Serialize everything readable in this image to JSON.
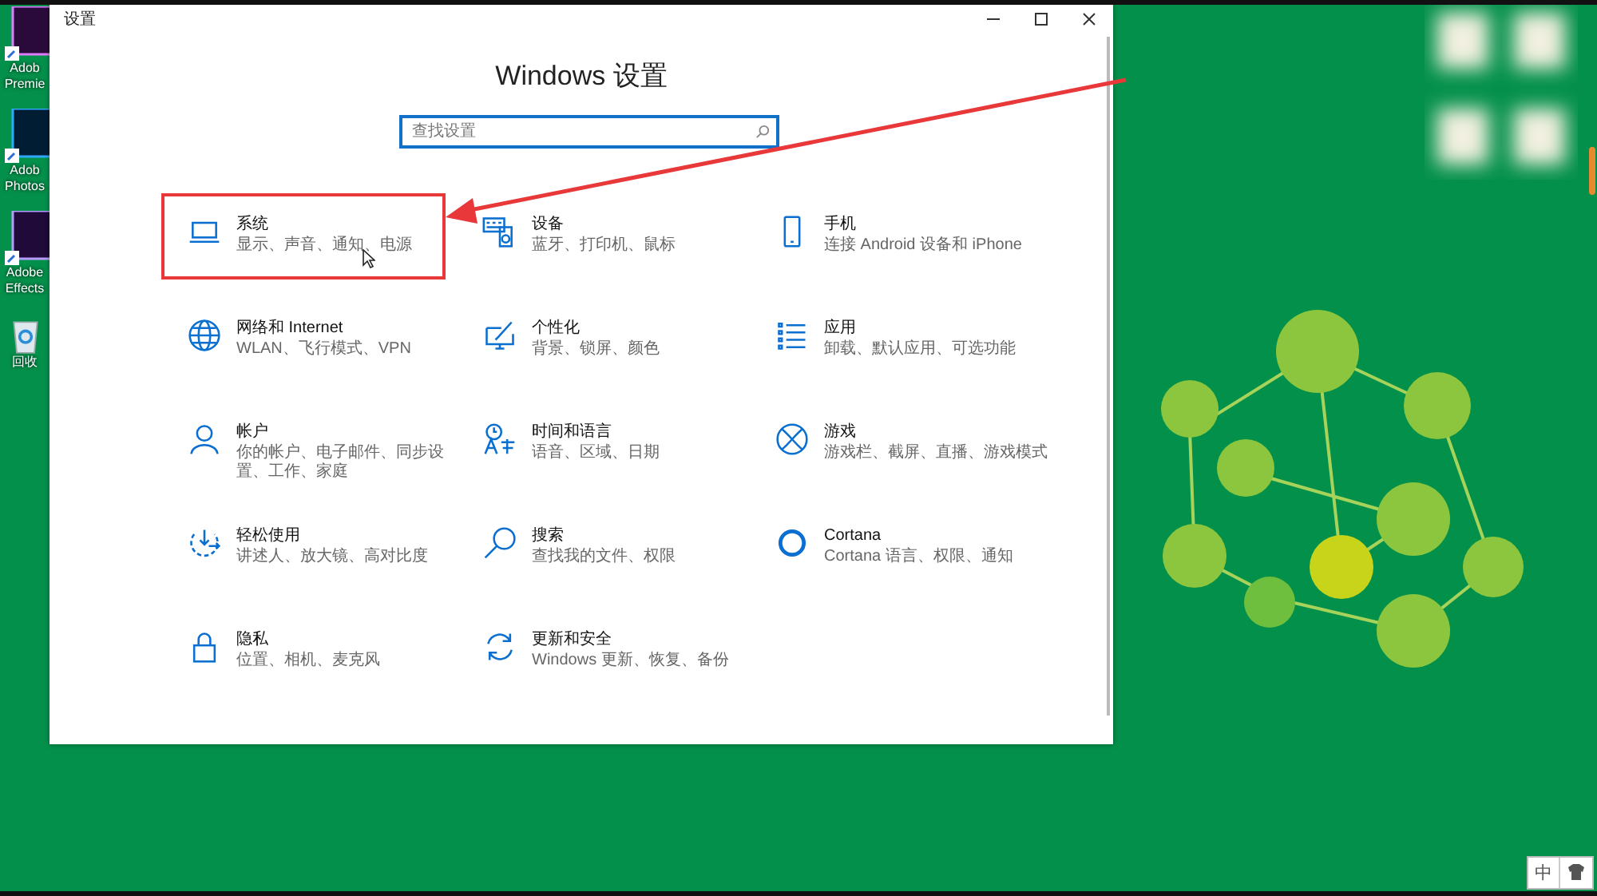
{
  "desktop_icons": [
    {
      "kind": "pr",
      "label_lines": [
        "Adob",
        "Premie"
      ]
    },
    {
      "kind": "ps",
      "label_lines": [
        "Adob",
        "Photos"
      ]
    },
    {
      "kind": "ae",
      "label_lines": [
        "Adobe",
        "Effects"
      ]
    },
    {
      "kind": "bin",
      "label_lines": [
        "回收"
      ]
    }
  ],
  "window": {
    "title": "设置",
    "heading": "Windows 设置",
    "search": {
      "placeholder": "查找设置"
    },
    "items": [
      {
        "title": "系统",
        "subtitle": "显示、声音、通知、电源",
        "annotated": true
      },
      {
        "title": "设备",
        "subtitle": "蓝牙、打印机、鼠标",
        "annotated": false
      },
      {
        "title": "手机",
        "subtitle": "连接 Android 设备和 iPhone",
        "annotated": false
      },
      {
        "title": "网络和 Internet",
        "subtitle": "WLAN、飞行模式、VPN",
        "annotated": false
      },
      {
        "title": "个性化",
        "subtitle": "背景、锁屏、颜色",
        "annotated": false
      },
      {
        "title": "应用",
        "subtitle": "卸载、默认应用、可选功能",
        "annotated": false
      },
      {
        "title": "帐户",
        "subtitle": "你的帐户、电子邮件、同步设置、工作、家庭",
        "annotated": false
      },
      {
        "title": "时间和语言",
        "subtitle": "语音、区域、日期",
        "annotated": false
      },
      {
        "title": "游戏",
        "subtitle": "游戏栏、截屏、直播、游戏模式",
        "annotated": false
      },
      {
        "title": "轻松使用",
        "subtitle": "讲述人、放大镜、高对比度",
        "annotated": false
      },
      {
        "title": "搜索",
        "subtitle": "查找我的文件、权限",
        "annotated": false
      },
      {
        "title": "Cortana",
        "subtitle": "Cortana 语言、权限、通知",
        "annotated": false
      },
      {
        "title": "隐私",
        "subtitle": "位置、相机、麦克风",
        "annotated": false
      },
      {
        "title": "更新和安全",
        "subtitle": "Windows 更新、恢复、备份",
        "annotated": false
      }
    ]
  },
  "ime": {
    "label": "中"
  }
}
